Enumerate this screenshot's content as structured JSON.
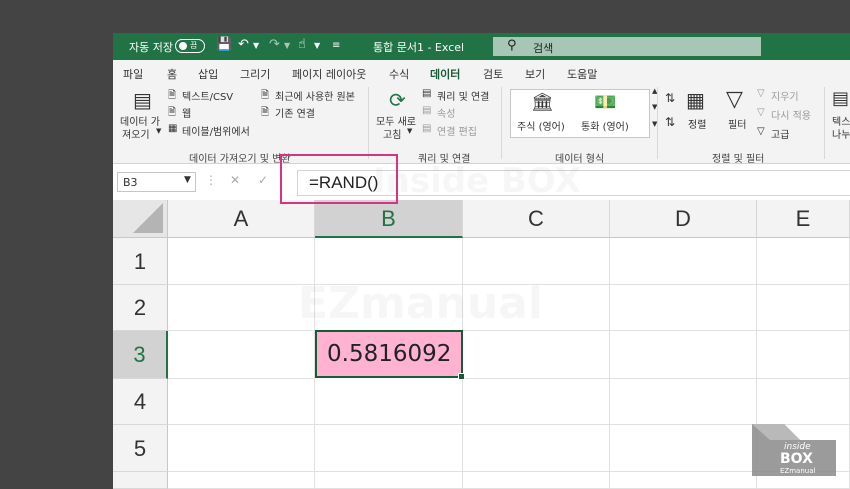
{
  "titlebar": {
    "autosave_label": "자동 저장",
    "autosave_state": "끔",
    "doc_title": "통합 문서1  -  Excel",
    "search_placeholder": "검색"
  },
  "tabs": [
    "파일",
    "홈",
    "삽입",
    "그리기",
    "페이지 레이아웃",
    "수식",
    "데이터",
    "검토",
    "보기",
    "도움말"
  ],
  "active_tab": "데이터",
  "ribbon": {
    "get_data_1": "데이터 가",
    "get_data_2": "져오기",
    "from_text_csv": "텍스트/CSV",
    "from_web": "웹",
    "from_table_range": "테이블/범위에서",
    "recent_sources": "최근에 사용한 원본",
    "existing_connections": "기존 연결",
    "group_get_data": "데이터 가져오기 및 변환",
    "refresh_all_1": "모두 새로",
    "refresh_all_2": "고침",
    "queries_connections": "쿼리 및 연결",
    "properties": "속성",
    "edit_links": "연결 편집",
    "group_queries": "쿼리 및 연결",
    "stocks": "주식 (영어)",
    "currencies": "통화 (영어)",
    "group_data_types": "데이터 형식",
    "sort": "정렬",
    "filter": "필터",
    "clear": "지우기",
    "reapply": "다시 적용",
    "advanced": "고급",
    "group_sort_filter": "정렬 및 필터",
    "text_to_cols_1": "텍스",
    "text_to_cols_2": "나누"
  },
  "formula_bar": {
    "name_box": "B3",
    "formula": "=RAND()"
  },
  "grid": {
    "columns": [
      "A",
      "B",
      "C",
      "D",
      "E"
    ],
    "rows": [
      "1",
      "2",
      "3",
      "4",
      "5"
    ],
    "selected_column": "B",
    "selected_row": "3",
    "active_cell_value": "0.5816092",
    "active_cell_fill": "#ffb3d1"
  },
  "watermark": {
    "line1": "Inside BOX",
    "line2": "EZmanual"
  },
  "logo": {
    "top": "inside",
    "mid": "BOX",
    "bot": "EZmanual"
  },
  "colors": {
    "excel_green": "#217346",
    "highlight_pink": "#d63384",
    "background": "#444444"
  }
}
